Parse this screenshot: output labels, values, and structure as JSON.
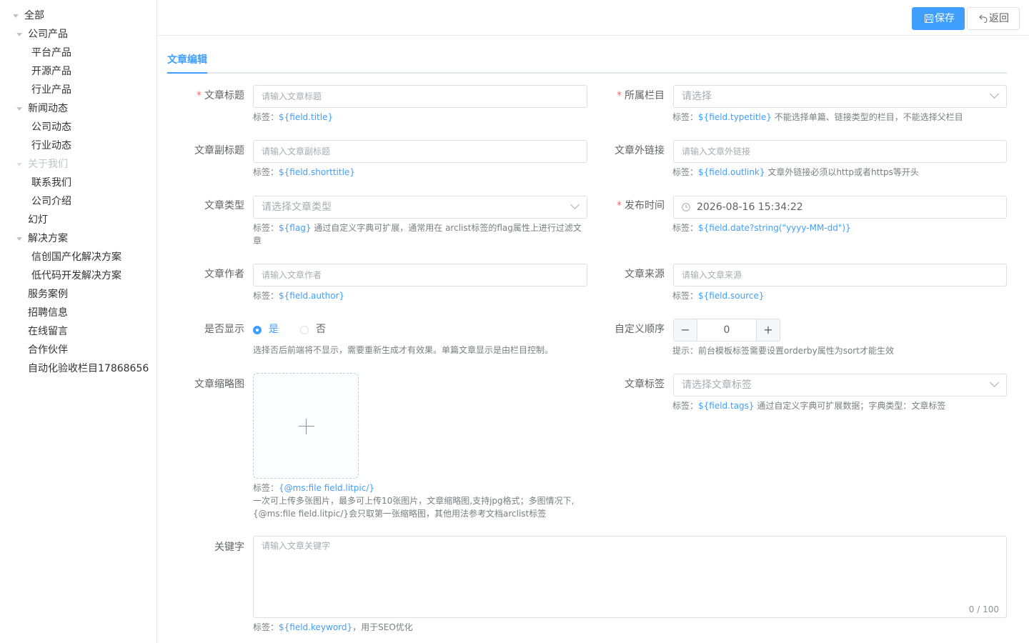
{
  "sidebar": {
    "items": [
      {
        "label": "全部"
      },
      {
        "label": "公司产品"
      },
      {
        "label": "平台产品"
      },
      {
        "label": "开源产品"
      },
      {
        "label": "行业产品"
      },
      {
        "label": "新闻动态"
      },
      {
        "label": "公司动态"
      },
      {
        "label": "行业动态"
      },
      {
        "label": "关于我们"
      },
      {
        "label": "联系我们"
      },
      {
        "label": "公司介绍"
      },
      {
        "label": "幻灯"
      },
      {
        "label": "解决方案"
      },
      {
        "label": "信创国产化解决方案"
      },
      {
        "label": "低代码开发解决方案"
      },
      {
        "label": "服务案例"
      },
      {
        "label": "招聘信息"
      },
      {
        "label": "在线留言"
      },
      {
        "label": "合作伙伴"
      },
      {
        "label": "自动化验收栏目17868656"
      }
    ]
  },
  "toolbar": {
    "save_label": "保存",
    "back_label": "返回"
  },
  "tabs": {
    "active": "文章编辑"
  },
  "form": {
    "title": {
      "label": "文章标题",
      "placeholder": "请输入文章标题",
      "tip_prefix": "标签：",
      "tip_code": "${field.title}"
    },
    "category": {
      "label": "所属栏目",
      "placeholder": "请选择",
      "tip_prefix": "标签：",
      "tip_code": "${field.typetitle}",
      "tip_suffix": " 不能选择单篇、链接类型的栏目，不能选择父栏目"
    },
    "subtitle": {
      "label": "文章副标题",
      "placeholder": "请输入文章副标题",
      "tip_prefix": "标签：",
      "tip_code": "${field.shorttitle}"
    },
    "outlink": {
      "label": "文章外链接",
      "placeholder": "请输入文章外链接",
      "tip_prefix": "标签：",
      "tip_code": "${field.outlink}",
      "tip_suffix": " 文章外链接必须以http或者https等开头"
    },
    "type": {
      "label": "文章类型",
      "placeholder": "请选择文章类型",
      "tip_prefix": "标签：",
      "tip_code": "${flag}",
      "tip_suffix": " 通过自定义字典可扩展，通常用在 arclist标签的flag属性上进行过滤文章"
    },
    "publish_time": {
      "label": "发布时间",
      "value": "2026-08-16 15:34:22",
      "tip_prefix": "标签：",
      "tip_code": "${field.date?string(\"yyyy-MM-dd\")}"
    },
    "author": {
      "label": "文章作者",
      "placeholder": "请输入文章作者",
      "tip_prefix": "标签：",
      "tip_code": "${field.author}"
    },
    "source": {
      "label": "文章来源",
      "placeholder": "请输入文章来源",
      "tip_prefix": "标签：",
      "tip_code": "${field.source}"
    },
    "display": {
      "label": "是否显示",
      "yes": "是",
      "no": "否",
      "selected": "是",
      "tip": "选择否后前端将不显示，需要重新生成才有效果。单篇文章显示是由栏目控制。"
    },
    "sort": {
      "label": "自定义顺序",
      "value": "0",
      "minus": "−",
      "plus": "+",
      "tip": "提示：前台模板标签需要设置orderby属性为sort才能生效"
    },
    "thumbnail": {
      "label": "文章缩略图",
      "tip_prefix": "标签：",
      "tip_code": "{@ms:file field.litpic/}",
      "tip_line2": "一次可上传多张图片，最多可上传10张图片，文章缩略图,支持jpg格式；多图情况下,",
      "tip_line3": "{@ms:file field.litpic/}会只取第一张缩略图，其他用法参考文档arclist标签"
    },
    "tags": {
      "label": "文章标签",
      "placeholder": "请选择文章标签",
      "tip_prefix": "标签：",
      "tip_code": "${field.tags}",
      "tip_suffix": " 通过自定义字典可扩展数据；字典类型：文章标签"
    },
    "keyword": {
      "label": "关键字",
      "placeholder": "请输入文章关键字",
      "count": "0 / 100",
      "tip_prefix": "标签：",
      "tip_code": "${field.keyword}",
      "tip_suffix": "，用于SEO优化"
    }
  },
  "colors": {
    "primary": "#409eff",
    "required": "#f56c6c"
  }
}
